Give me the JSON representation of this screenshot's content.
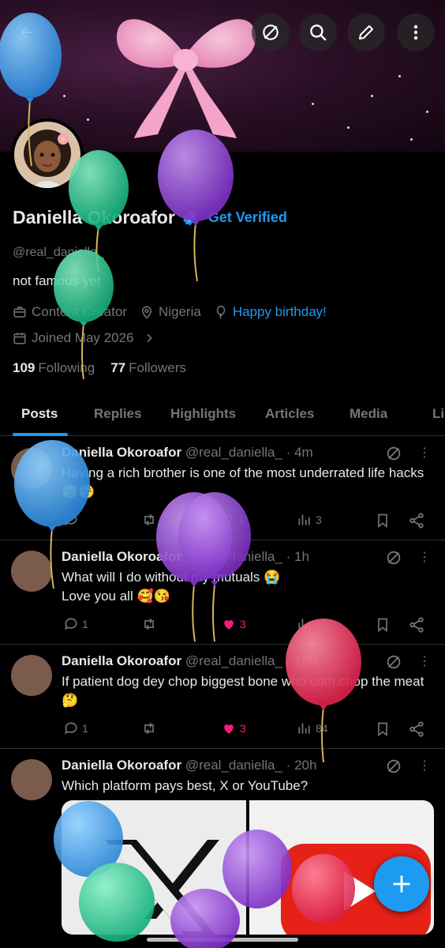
{
  "header": {
    "back_icon": "arrow-left-icon",
    "buttons": [
      "grok-icon",
      "search-icon",
      "edit-icon",
      "more-vertical-icon"
    ]
  },
  "profile": {
    "name": "Daniella Okoroafor",
    "get_verified": "Get Verified",
    "handle": "@real_daniella_",
    "bio": "not famous yet",
    "category": "Content Creator",
    "location": "Nigeria",
    "birthday": "Happy birthday!",
    "joined": "Joined May 2026",
    "following_count": "109",
    "following_label": "Following",
    "followers_count": "77",
    "followers_label": "Followers"
  },
  "tabs": [
    "Posts",
    "Replies",
    "Highlights",
    "Articles",
    "Media",
    "Li"
  ],
  "posts": [
    {
      "name": "Daniella Okoroafor",
      "handle_time": "@real_daniella_ · 4m",
      "text": "Having a rich brother is one of the most underrated life hacks 😌😌",
      "replies": "",
      "reposts": "",
      "likes": "1",
      "views": "3"
    },
    {
      "name": "Daniella Okoroafor",
      "handle_time": "@real_daniella_ · 1h",
      "text": "What will I do without my mutuals 😭",
      "text2": "Love you all 🥰😘",
      "replies": "1",
      "reposts": "",
      "likes": "3",
      "views": "19"
    },
    {
      "name": "Daniella Okoroafor",
      "handle_time": "@real_daniella_ · 18h",
      "text": "If patient dog dey chop biggest bone who com chop the meat 🤔",
      "replies": "1",
      "reposts": "",
      "likes": "3",
      "views": "84"
    },
    {
      "name": "Daniella Okoroafor",
      "handle_time": "@real_daniella_ · 20h",
      "text": "Which platform pays best, X or YouTube?"
    }
  ],
  "colors": {
    "accent": "#1d9bf0",
    "like": "#f91880",
    "muted": "#71767b"
  }
}
